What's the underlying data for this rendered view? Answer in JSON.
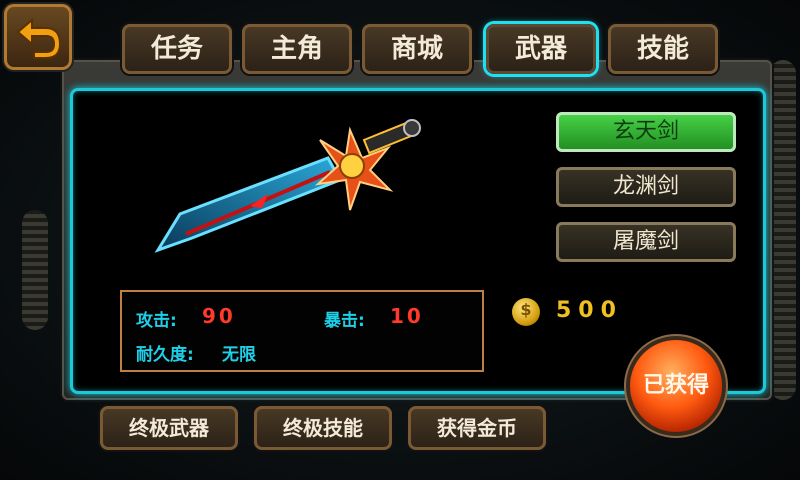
{
  "tabs": [
    {
      "label": "任务"
    },
    {
      "label": "主角"
    },
    {
      "label": "商城"
    },
    {
      "label": "武器",
      "active": true
    },
    {
      "label": "技能"
    }
  ],
  "weapons": [
    {
      "label": "玄天剑",
      "selected": true
    },
    {
      "label": "龙渊剑"
    },
    {
      "label": "屠魔剑"
    }
  ],
  "stats": {
    "attack_label": "攻击:",
    "attack_value": "90",
    "crit_label": "暴击:",
    "crit_value": "10",
    "durability_label": "耐久度:",
    "durability_value": "无限"
  },
  "price": {
    "icon": "gold-coin-icon",
    "coin_symbol": "$",
    "value": "500"
  },
  "obtained_button": "已获得",
  "bottom_buttons": [
    {
      "label": "终极武器"
    },
    {
      "label": "终极技能"
    },
    {
      "label": "获得金币"
    }
  ],
  "colors": {
    "accent": "#1ec8d8",
    "stat_value": "#ff3a2a",
    "selected_weapon": "#3cc83c"
  }
}
